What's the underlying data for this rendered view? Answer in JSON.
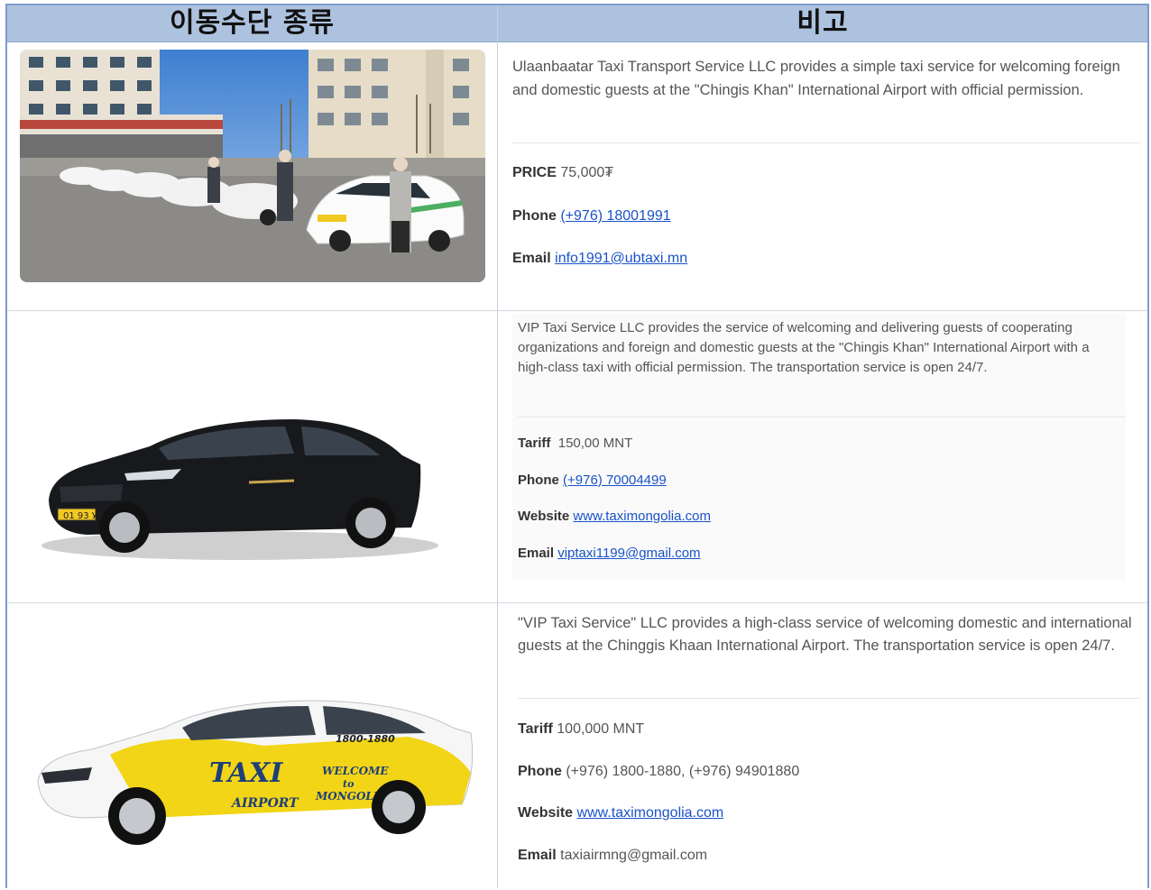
{
  "header": {
    "col1": "이동수단 종류",
    "col2": "비고"
  },
  "rows": [
    {
      "image_alt": "Row of white taxis with drivers at Ulaanbaatar",
      "intro": "Ulaanbaatar Taxi Transport Service LLC provides a simple taxi service for welcoming foreign and domestic guests at the \"Chingis Khan\" International Airport with official permission.",
      "price_label": "PRICE",
      "price_value": "75,000₮",
      "phone_label": "Phone",
      "phone_value": "(+976) 18001991",
      "email_label": "Email",
      "email_value": "info1991@ubtaxi.mn",
      "plate": ""
    },
    {
      "image_alt": "Black VIP taxi sedan",
      "intro": "VIP Taxi Service LLC provides the service of welcoming and delivering guests of cooperating organizations and foreign and domestic guests at the \"Chingis Khan\" International Airport with a high-class taxi with official permission. The transportation service is open 24/7.",
      "tariff_label": "Tariff",
      "tariff_value": "150,00 MNT",
      "phone_label": "Phone",
      "phone_value": "(+976) 70004499",
      "website_label": "Website",
      "website_value": "www.taximongolia.com",
      "email_label": "Email",
      "email_value": "viptaxi1199@gmail.com",
      "plate": "01 93 УБЕ"
    },
    {
      "image_alt": "White and yellow airport taxi",
      "intro": "\"VIP Taxi Service\" LLC provides a high-class service of welcoming domestic and international guests at the Chinggis Khaan International Airport. The transportation service is open 24/7.",
      "tariff_label": "Tariff",
      "tariff_value": "100,000 MNT",
      "phone_label": "Phone",
      "phone_value": "(+976) 1800-1880,  (+976)  94901880",
      "website_label": "Website",
      "website_value": "www.taximongolia.com",
      "email_label": "Email",
      "email_value": "taxiairmng@gmail.com",
      "decal_taxi": "TAXI",
      "decal_airport": "AIRPORT",
      "decal_welcome": "WELCOME",
      "decal_to": "to",
      "decal_mongolia": "MONGOLIA",
      "decal_phone": "1800-1880"
    }
  ],
  "colors": {
    "header_bg": "#adc2de",
    "border": "#7d9ccc",
    "link": "#1a52c9",
    "taxi_yellow": "#f2d516"
  }
}
